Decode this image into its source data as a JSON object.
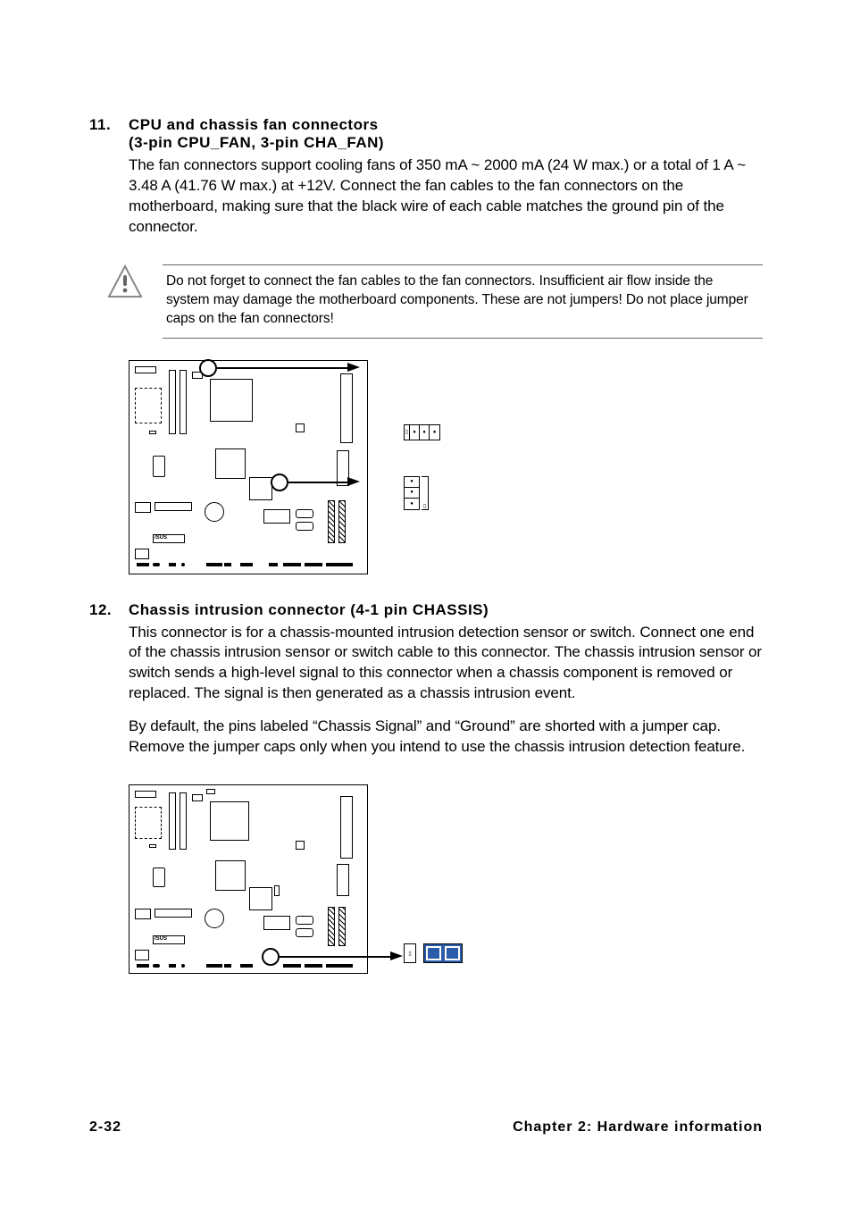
{
  "section1": {
    "number": "11.",
    "title_line1": "CPU and chassis fan connectors",
    "title_line2": "(3-pin CPU_FAN, 3-pin CHA_FAN)",
    "body": "The fan connectors support cooling fans of 350 mA ~ 2000 mA (24 W max.) or a total of 1 A ~ 3.48 A (41.76 W max.) at +12V. Connect the fan cables to the fan connectors on the motherboard, making sure that the black wire of each cable matches the ground pin of the connector."
  },
  "note1": "Do not forget to connect the fan cables to the fan connectors. Insufficient air flow inside the system may damage the motherboard components. These are not jumpers! Do not place jumper caps on the fan connectors!",
  "section2": {
    "number": "12.",
    "title": "Chassis intrusion connector (4-1 pin CHASSIS)",
    "body1": "This connector is for a chassis-mounted intrusion detection sensor or switch. Connect one end of the chassis intrusion sensor or switch cable to this connector. The chassis intrusion sensor or switch sends a high-level signal to this connector when a chassis component is removed or replaced. The signal is then generated as a chassis intrusion event.",
    "body2": "By default, the pins labeled “Chassis Signal” and “Ground” are shorted with a jumper cap. Remove the jumper caps only when you intend to use the chassis intrusion detection feature."
  },
  "footer": {
    "left": "2-32",
    "right": "Chapter 2: Hardware information"
  },
  "labels": {
    "cpu_fan": "CPU_FAN",
    "cha_fan": "CHA_FAN",
    "chassis": "CHASSIS",
    "brand": "/SUS"
  }
}
